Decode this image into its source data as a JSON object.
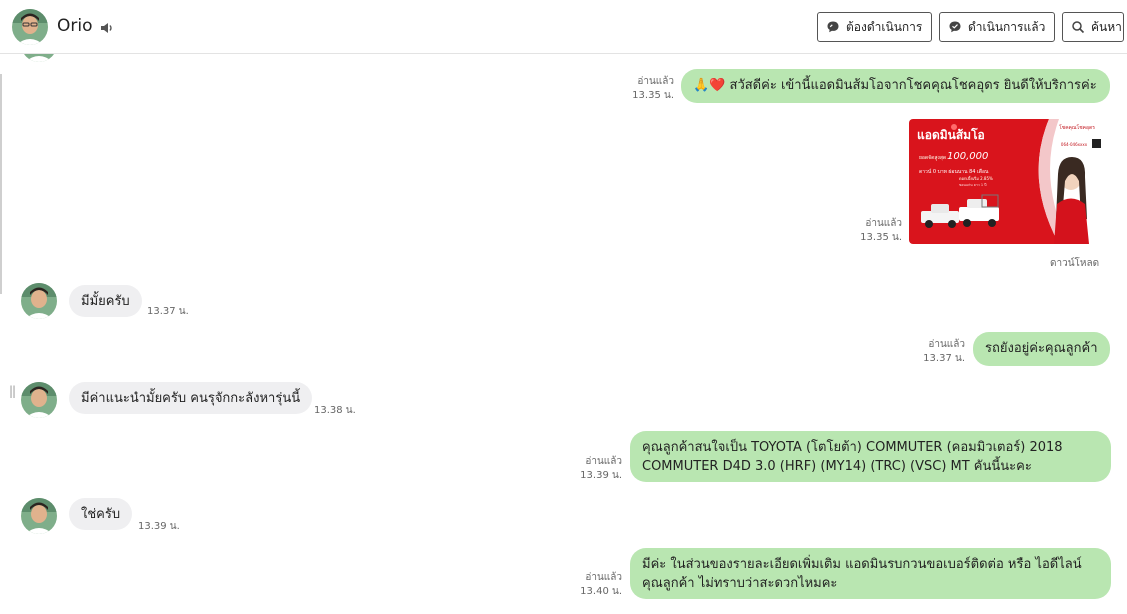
{
  "header": {
    "contact_name": "Orio",
    "btn_pending": "ต้องดำเนินการ",
    "btn_done": "ดำเนินการแล้ว",
    "btn_search": "ค้นหา"
  },
  "messages": [
    {
      "from": "agent",
      "text": "สวัสดีค่ะ เข้านี้แอดมินส้มโอจากโชคคุณโชคอุดร ยินดีให้บริการค่ะ",
      "emoji": "🙏❤️",
      "status": "อ่านแล้ว",
      "time": "13.35 น."
    },
    {
      "from": "agent",
      "type": "image",
      "status": "อ่านแล้ว",
      "time": "13.35 น.",
      "download": "ดาวน์โหลด",
      "image": {
        "headline": "แอดมินส้มโอ",
        "corner_text": "โชคคุณโชคอุดร",
        "amount": "100,000",
        "line1": "ดาวน์ 0 บาท ผ่อนนาน 84 เดือน",
        "line2": "ดอกเบี้ยเริ่ม 2.85%",
        "line3": "ขอนแก่น ยาว 1 ปี",
        "label_top": "ยอดจัดสูงสุด",
        "cta": "064-046xxxx"
      }
    },
    {
      "from": "customer",
      "text": "มีมั้ยครับ",
      "time": "13.37 น."
    },
    {
      "from": "agent",
      "text": "รถยังอยู่ค่ะคุณลูกค้า",
      "status": "อ่านแล้ว",
      "time": "13.37 น."
    },
    {
      "from": "customer",
      "text": "มีค่าแนะนำมั้ยครับ คนรุจักกะลังหารุ่นนี้",
      "time": "13.38 น."
    },
    {
      "from": "agent",
      "text_line1": "คุณลูกค้าสนใจเป็น TOYOTA (โตโยต้า) COMMUTER (คอมมิวเตอร์) 2018",
      "text_line2": "COMMUTER D4D 3.0 (HRF) (MY14) (TRC) (VSC) MT  คันนี้นะคะ",
      "status": "อ่านแล้ว",
      "time": "13.39 น."
    },
    {
      "from": "customer",
      "text": "ใช่ครับ",
      "time": "13.39 น."
    },
    {
      "from": "agent",
      "text_line1": "มีค่ะ ในส่วนของรายละเอียดเพิ่มเติม แอดมินรบกวนขอเบอร์ติดต่อ หรือ ไอดีไลน์",
      "text_line2": "คุณลูกค้า ไม่ทราบว่าสะดวกไหมคะ",
      "status": "อ่านแล้ว",
      "time": "13.40 น."
    }
  ],
  "colors": {
    "agent_bubble": "#b9e6b1",
    "customer_bubble": "#efeff1",
    "promo_red": "#d9141c"
  },
  "icons": {
    "speaker": "speaker-icon",
    "pending": "chat-pending-icon",
    "done": "chat-done-icon",
    "search": "search-icon"
  }
}
